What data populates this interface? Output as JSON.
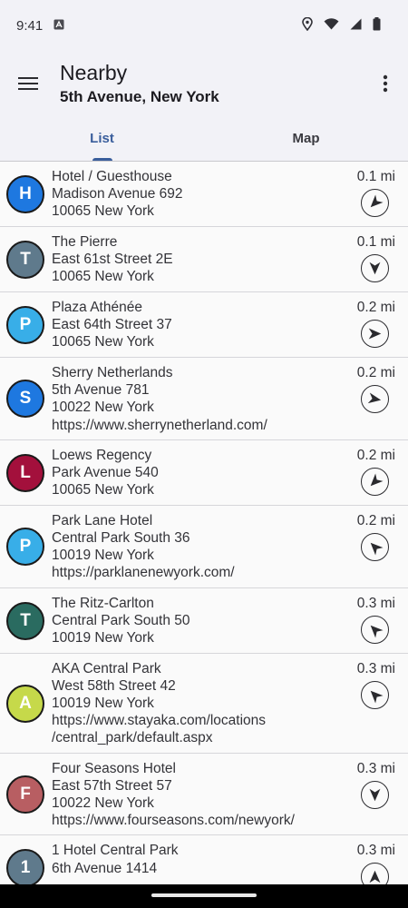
{
  "status_bar": {
    "time": "9:41"
  },
  "app_bar": {
    "title": "Nearby",
    "subtitle": "5th Avenue, New York"
  },
  "tabs": [
    {
      "label": "List",
      "active": true
    },
    {
      "label": "Map",
      "active": false
    }
  ],
  "colors": {
    "accent": "#3a5e9c"
  },
  "places": [
    {
      "letter": "H",
      "color": "#1e78e0",
      "lines": [
        "Hotel / Guesthouse",
        "Madison Avenue 692",
        "10065 New York"
      ],
      "distance": "0.1 mi",
      "bearing": 225
    },
    {
      "letter": "T",
      "color": "#5f7a8c",
      "lines": [
        "The Pierre",
        "East 61st Street 2E",
        "10065 New York"
      ],
      "distance": "0.1 mi",
      "bearing": 180
    },
    {
      "letter": "P",
      "color": "#38aee8",
      "lines": [
        "Plaza Athénée",
        "East 64th Street 37",
        "10065 New York"
      ],
      "distance": "0.2 mi",
      "bearing": 90
    },
    {
      "letter": "S",
      "color": "#1e78e0",
      "lines": [
        "Sherry Netherlands",
        "5th Avenue 781",
        "10022 New York",
        "https://www.sherrynetherland.com/"
      ],
      "distance": "0.2 mi",
      "bearing": 100
    },
    {
      "letter": "L",
      "color": "#a3103c",
      "lines": [
        "Loews Regency",
        "Park Avenue 540",
        "10065 New York"
      ],
      "distance": "0.2 mi",
      "bearing": 225
    },
    {
      "letter": "P",
      "color": "#38aee8",
      "lines": [
        "Park Lane Hotel",
        "Central Park South 36",
        "10019 New York",
        "https://parklanenewyork.com/"
      ],
      "distance": "0.2 mi",
      "bearing": 315
    },
    {
      "letter": "T",
      "color": "#2a6b60",
      "lines": [
        "The Ritz-Carlton",
        "Central Park South 50",
        "10019 New York"
      ],
      "distance": "0.3 mi",
      "bearing": 315
    },
    {
      "letter": "A",
      "color": "#c6d94a",
      "lines": [
        "AKA Central Park",
        "West 58th Street 42",
        "10019 New York",
        "https://www.stayaka.com/locations",
        "/central_park/default.aspx"
      ],
      "distance": "0.3 mi",
      "bearing": 315
    },
    {
      "letter": "F",
      "color": "#b85e62",
      "lines": [
        "Four Seasons Hotel",
        "East 57th Street 57",
        "10022 New York",
        "https://www.fourseasons.com/newyork/"
      ],
      "distance": "0.3 mi",
      "bearing": 180
    },
    {
      "letter": "1",
      "color": "#5f7a8c",
      "lines": [
        "1 Hotel Central Park",
        "6th Avenue 1414"
      ],
      "distance": "0.3 mi",
      "bearing": 0
    }
  ]
}
